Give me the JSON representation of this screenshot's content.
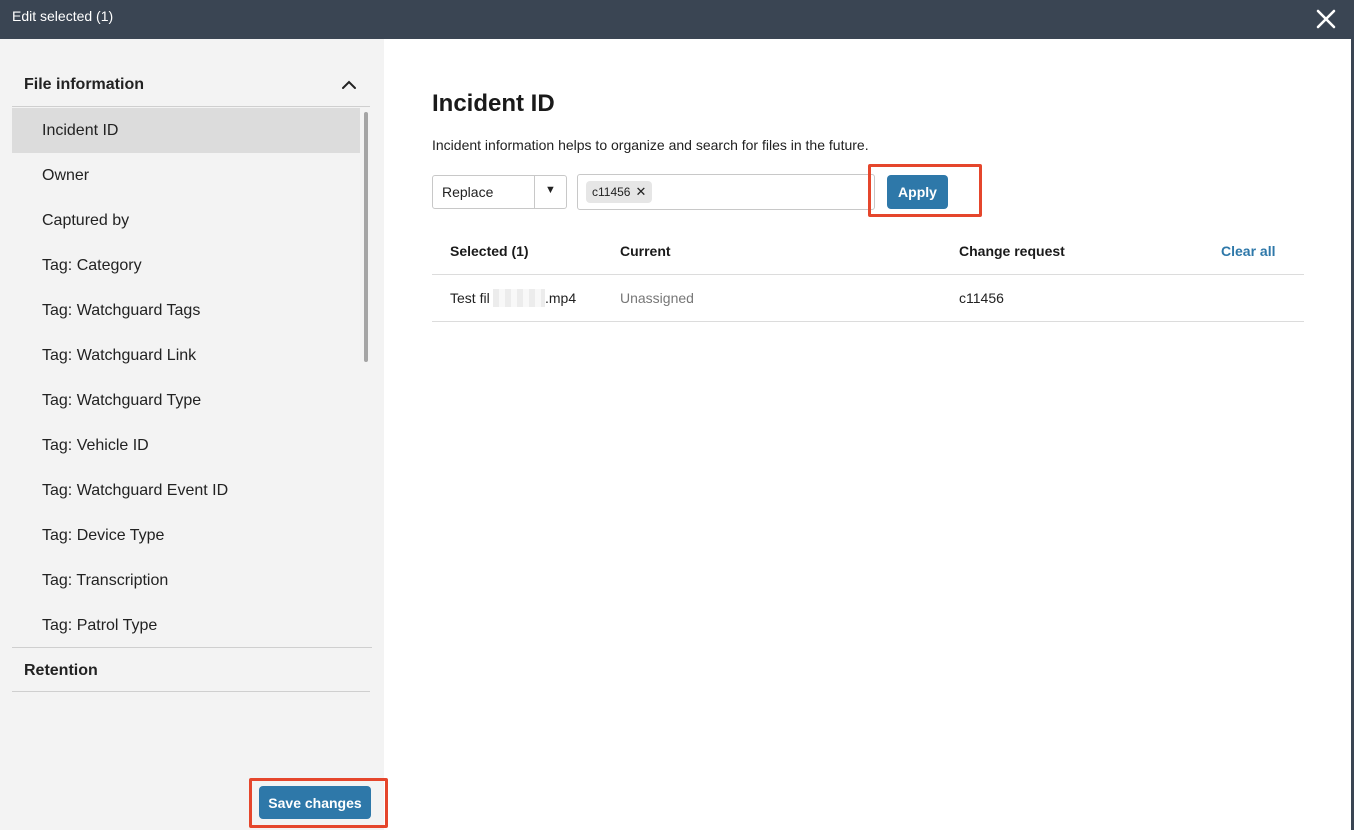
{
  "window": {
    "title": "Edit selected (1)"
  },
  "sidebar": {
    "section_file_info": "File information",
    "items": [
      {
        "label": "Incident ID",
        "active": true
      },
      {
        "label": "Owner"
      },
      {
        "label": "Captured by"
      },
      {
        "label": "Tag: Category"
      },
      {
        "label": "Tag: Watchguard Tags"
      },
      {
        "label": "Tag: Watchguard Link"
      },
      {
        "label": "Tag: Watchguard Type"
      },
      {
        "label": "Tag: Vehicle ID"
      },
      {
        "label": "Tag: Watchguard Event ID"
      },
      {
        "label": "Tag: Device Type"
      },
      {
        "label": "Tag: Transcription"
      },
      {
        "label": "Tag: Patrol Type"
      }
    ],
    "section_retention": "Retention",
    "save_label": "Save changes"
  },
  "main": {
    "title": "Incident ID",
    "description": "Incident information helps to organize and search for files in the future.",
    "mode_select": "Replace",
    "chip": "c11456",
    "apply_label": "Apply",
    "table": {
      "headers": [
        "Selected (1)",
        "Current",
        "Change request"
      ],
      "clear_all": "Clear all",
      "row": {
        "file_prefix": "Test fil",
        "file_suffix": ".mp4",
        "current": "Unassigned",
        "change": "c11456"
      }
    }
  },
  "colors": {
    "header_bg": "#3a4553",
    "accent": "#2e78a9",
    "highlight": "#e5462c",
    "sidebar_bg": "#f3f3f3"
  }
}
